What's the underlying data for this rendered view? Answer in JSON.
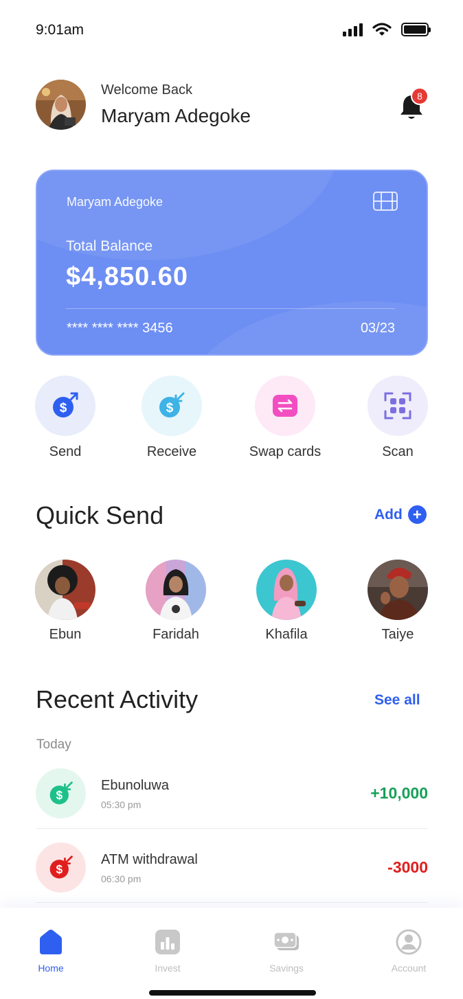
{
  "status_bar": {
    "time": "9:01am"
  },
  "header": {
    "welcome": "Welcome Back",
    "user_name": "Maryam Adegoke",
    "notification_count": "8"
  },
  "card": {
    "holder": "Maryam Adegoke",
    "balance_label": "Total Balance",
    "balance": "$4,850.60",
    "number": "**** **** **** 3456",
    "expiry": "03/23",
    "color": "#6d8ef3"
  },
  "actions": [
    {
      "label": "Send",
      "icon": "send-money-icon",
      "bg": "#e8ecfb",
      "color": "#2f5ff0"
    },
    {
      "label": "Receive",
      "icon": "receive-money-icon",
      "bg": "#e6f6fb",
      "color": "#3fb2e6"
    },
    {
      "label": "Swap cards",
      "icon": "swap-icon",
      "bg": "#fdeaf6",
      "color": "#f24ec2"
    },
    {
      "label": "Scan",
      "icon": "scan-icon",
      "bg": "#efedfb",
      "color": "#7b6fe0"
    }
  ],
  "quick_send": {
    "title": "Quick Send",
    "add_label": "Add",
    "contacts": [
      {
        "name": "Ebun"
      },
      {
        "name": "Faridah"
      },
      {
        "name": "Khafila"
      },
      {
        "name": "Taiye"
      }
    ]
  },
  "recent_activity": {
    "title": "Recent Activity",
    "see_all": "See all",
    "group_label": "Today",
    "transactions": [
      {
        "name": "Ebunoluwa",
        "time": "05:30 pm",
        "amount": "+10,000",
        "color": "#18a058",
        "icon": "receive-money-icon"
      },
      {
        "name": "ATM withdrawal",
        "time": "06:30 pm",
        "amount": "-3000",
        "color": "#e01e1e",
        "icon": "withdraw-money-icon"
      }
    ]
  },
  "nav": {
    "items": [
      {
        "label": "Home",
        "icon": "home-icon"
      },
      {
        "label": "Invest",
        "icon": "chart-icon"
      },
      {
        "label": "Savings",
        "icon": "cash-icon"
      },
      {
        "label": "Account",
        "icon": "user-icon"
      }
    ],
    "active_color": "#2f5ff0"
  }
}
